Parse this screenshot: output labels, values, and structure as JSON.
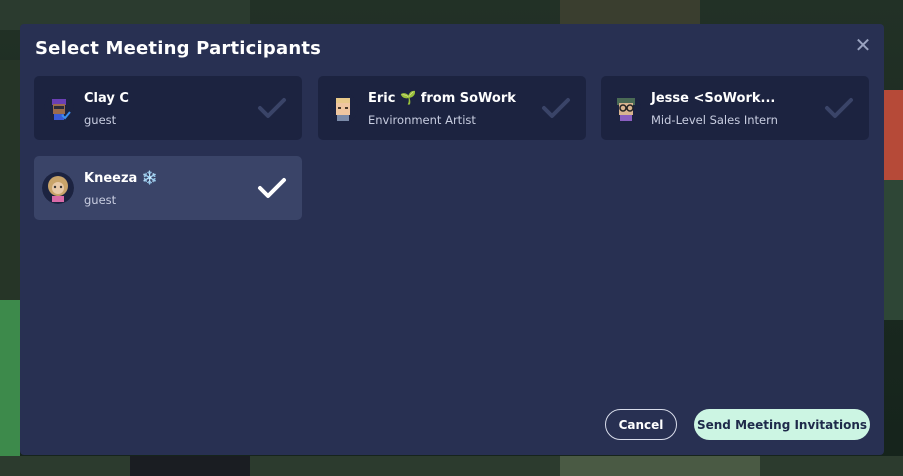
{
  "modal": {
    "title": "Select Meeting Participants",
    "close_glyph": "✕"
  },
  "participants": [
    {
      "name": "Clay C",
      "role": "guest",
      "selected": false,
      "avatar": "avatar-purple-hair"
    },
    {
      "name": "Eric 🌱 from SoWork",
      "role": "Environment Artist",
      "selected": false,
      "avatar": "avatar-blonde"
    },
    {
      "name": "Jesse <SoWork...",
      "role": "Mid-Level Sales Intern",
      "selected": false,
      "avatar": "avatar-glasses"
    },
    {
      "name": "Kneeza ❄️",
      "role": "guest",
      "selected": true,
      "avatar": "avatar-curly"
    }
  ],
  "buttons": {
    "cancel_label": "Cancel",
    "send_label": "Send Meeting Invitations"
  },
  "colors": {
    "modal_bg": "#283052",
    "card_bg": "#1c2340",
    "card_selected_bg": "#3a4468",
    "check_inactive": "#3a4468",
    "check_active": "#ffffff",
    "send_button_bg": "#ccf5e3"
  }
}
